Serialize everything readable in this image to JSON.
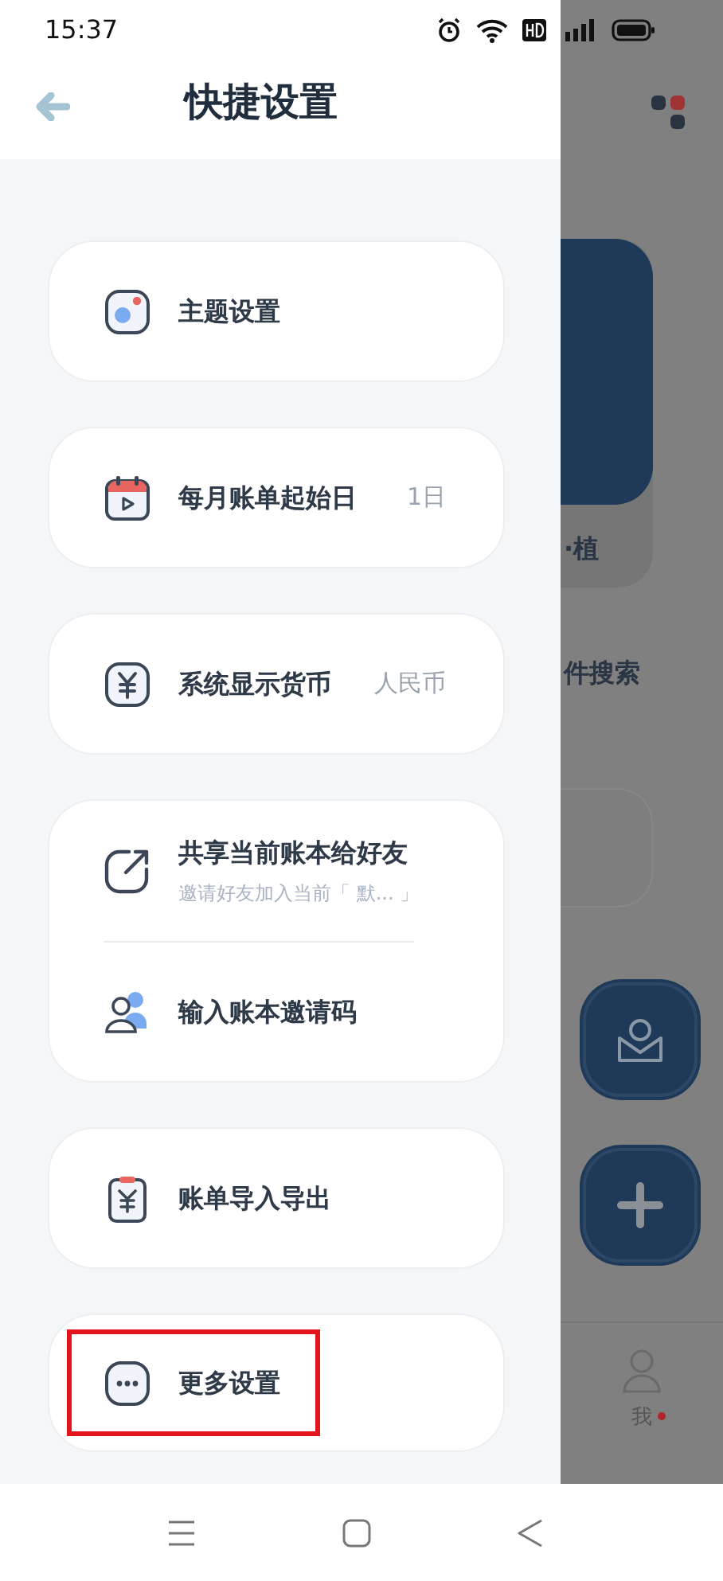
{
  "status_bar": {
    "time": "15:37"
  },
  "drawer": {
    "title": "快捷设置",
    "groups": [
      {
        "items": [
          {
            "kind": "theme",
            "label": "主题设置",
            "highlighted": false
          }
        ]
      },
      {
        "items": [
          {
            "kind": "calendar",
            "label": "每月账单起始日",
            "value": "1日",
            "highlighted": false
          }
        ]
      },
      {
        "items": [
          {
            "kind": "currency",
            "label": "系统显示货币",
            "value": "人民币",
            "highlighted": false
          }
        ]
      },
      {
        "items": [
          {
            "kind": "share",
            "label": "共享当前账本给好友",
            "subtitle": "邀请好友加入当前「 默... 」",
            "highlighted": false
          },
          {
            "kind": "people",
            "label": "输入账本邀请码",
            "highlighted": false
          }
        ]
      },
      {
        "items": [
          {
            "kind": "bill",
            "label": "账单导入导出",
            "highlighted": false
          }
        ]
      },
      {
        "items": [
          {
            "kind": "more",
            "label": "更多设置",
            "highlighted": true
          }
        ]
      }
    ]
  },
  "background_app": {
    "card_caption": "·植",
    "search_label": "件搜索",
    "me_tab": {
      "label": "我",
      "badge": true
    }
  }
}
